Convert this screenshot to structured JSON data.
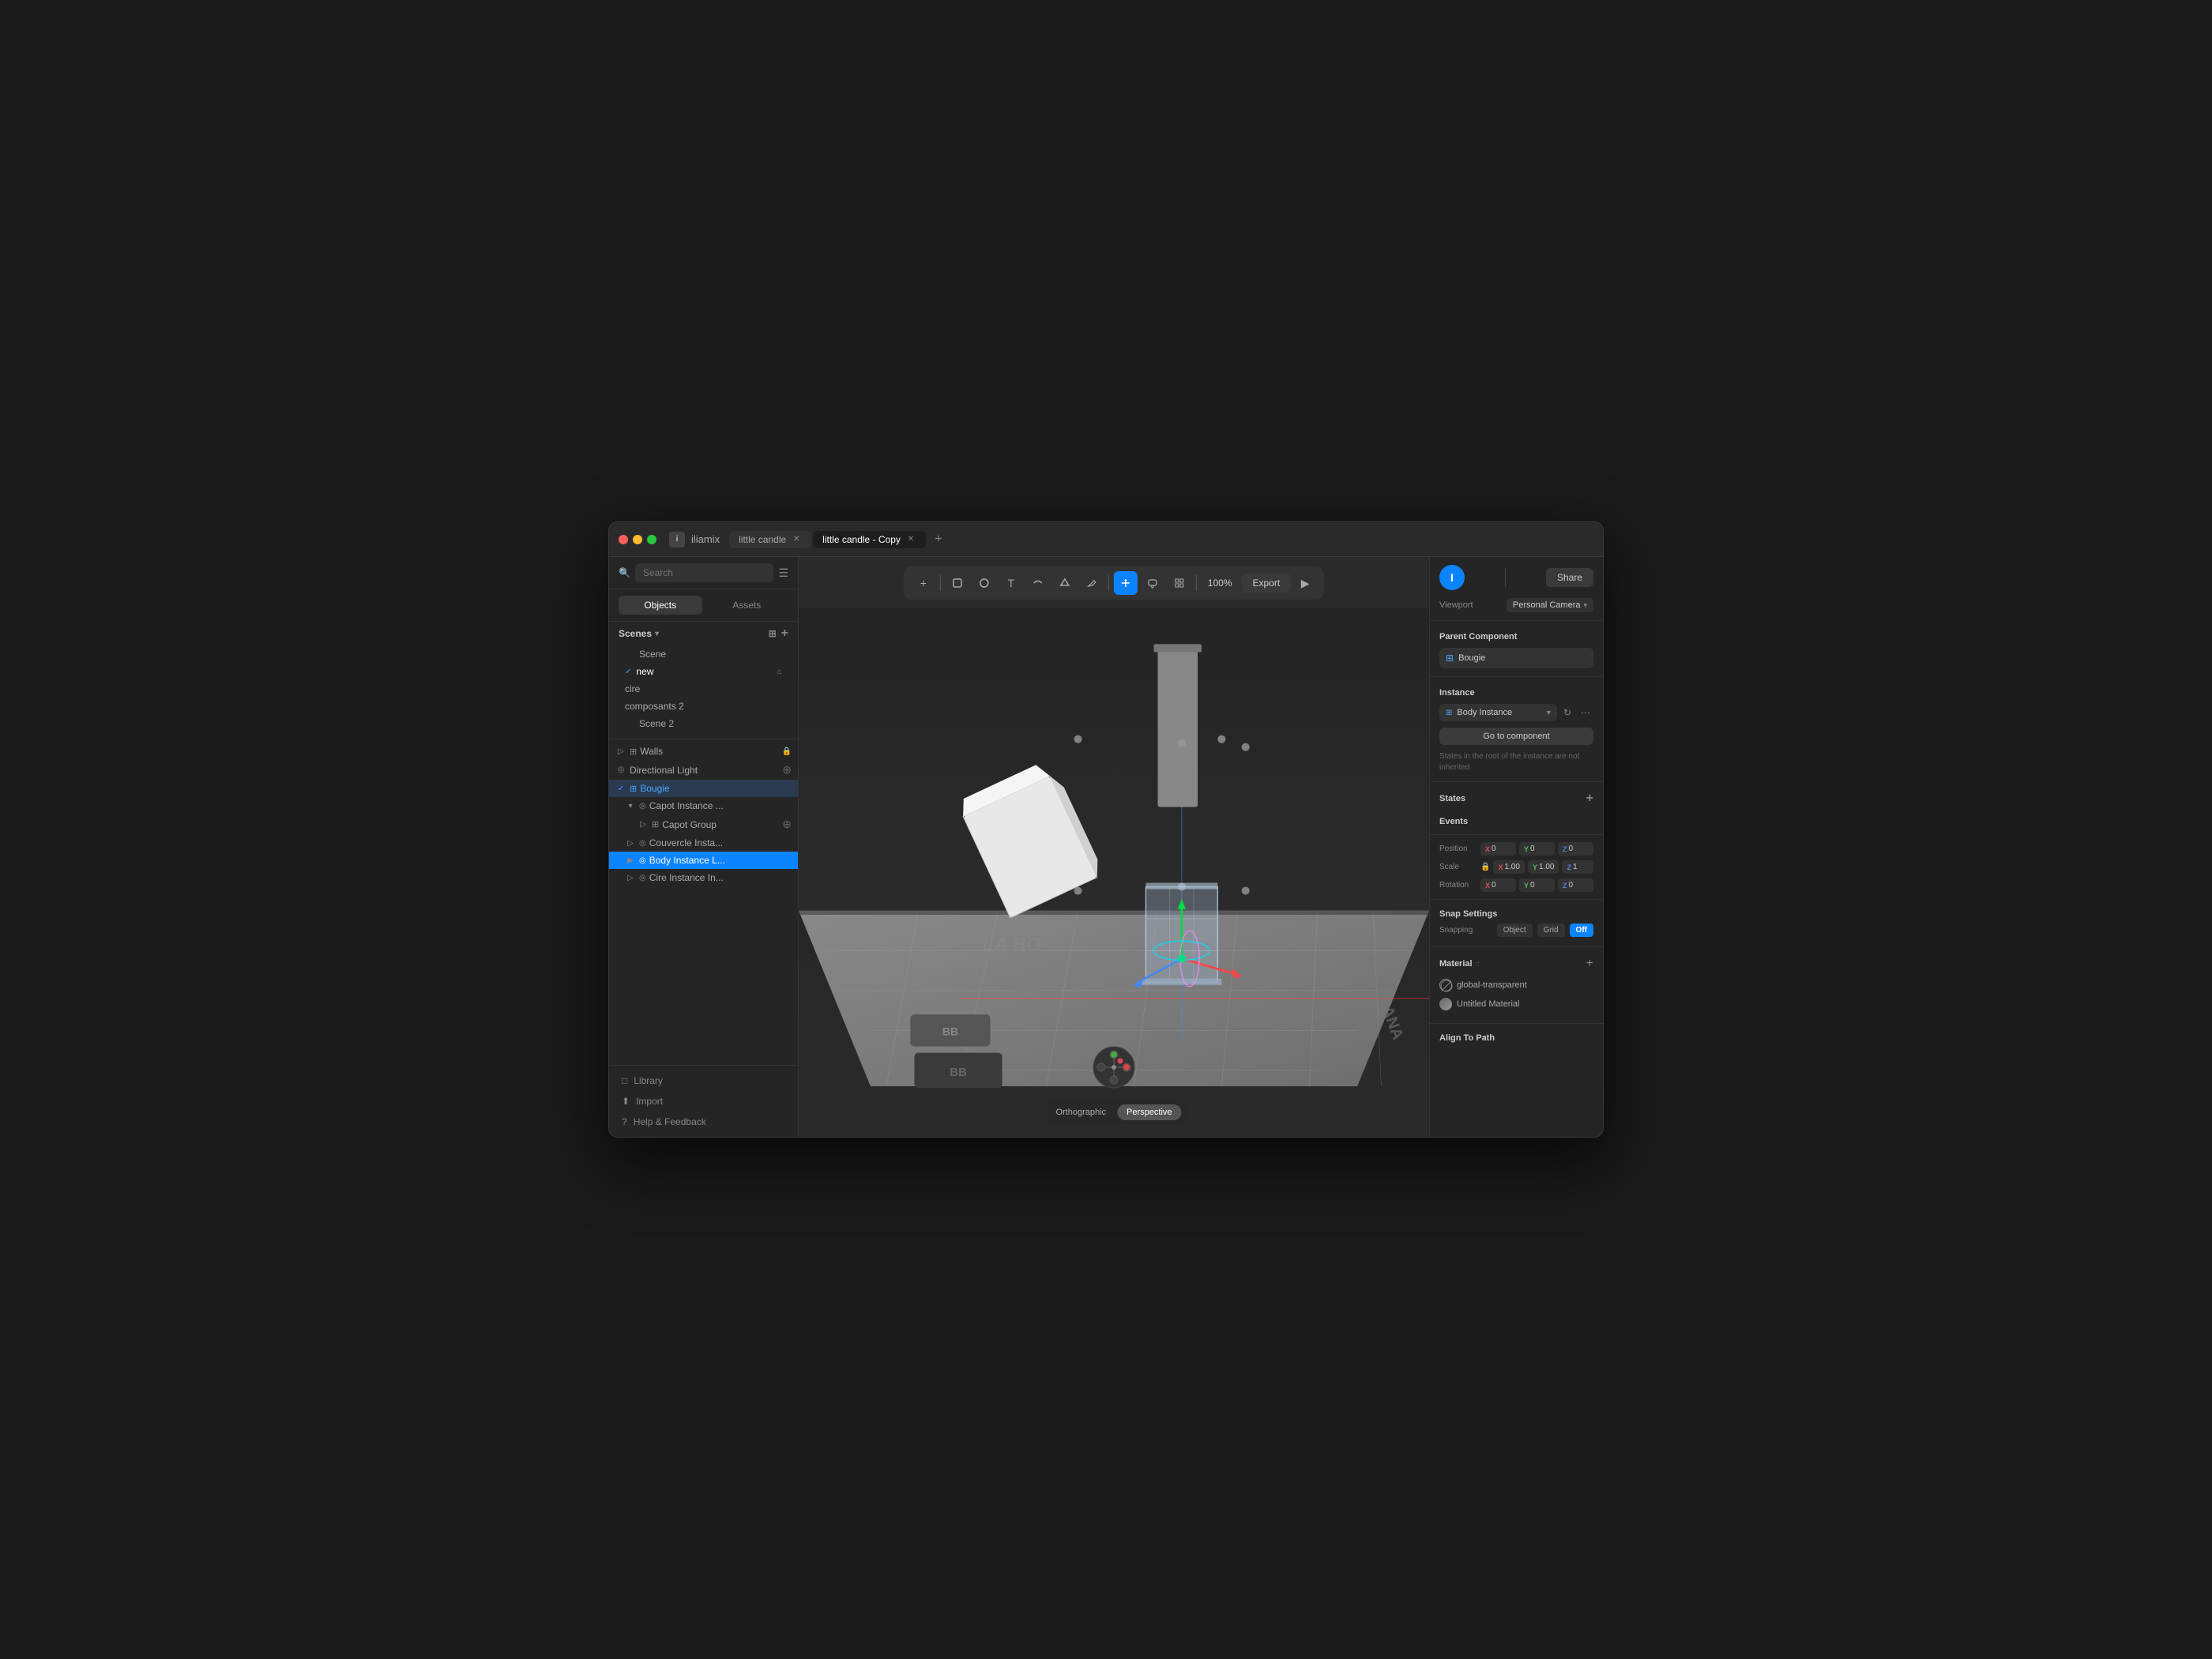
{
  "window": {
    "app_icon": "i",
    "app_name": "iliamix",
    "tabs": [
      {
        "label": "little candle",
        "active": false
      },
      {
        "label": "little candle - Copy",
        "active": true
      }
    ],
    "tab_add": "+"
  },
  "toolbar": {
    "zoom": "100%",
    "export_label": "Export"
  },
  "left_panel": {
    "search_placeholder": "Search",
    "tabs": [
      {
        "label": "Objects",
        "active": true
      },
      {
        "label": "Assets",
        "active": false
      }
    ],
    "scenes_label": "Scenes",
    "scenes": [
      {
        "label": "Scene",
        "active": false,
        "check": false
      },
      {
        "label": "new",
        "active": true,
        "check": true
      },
      {
        "label": "cire",
        "active": false,
        "check": false
      },
      {
        "label": "composants 2",
        "active": false,
        "check": false
      },
      {
        "label": "Scene 2",
        "active": false,
        "check": false
      }
    ],
    "tree": [
      {
        "label": "Walls",
        "icon": "▷",
        "indent": 0,
        "lock": true,
        "type": "group"
      },
      {
        "label": "Directional Light",
        "icon": "◎",
        "indent": 0,
        "type": "light",
        "plus": true
      },
      {
        "label": "Bougie",
        "icon": "⊞",
        "indent": 0,
        "type": "component",
        "highlighted": true
      },
      {
        "label": "Capot Instance ...",
        "icon": "◎",
        "indent": 1,
        "type": "instance"
      },
      {
        "label": "Capot Group",
        "icon": "▷",
        "indent": 2,
        "type": "group",
        "plus": true
      },
      {
        "label": "Couvercle Insta...",
        "icon": "◎",
        "indent": 1,
        "type": "instance"
      },
      {
        "label": "Body Instance L...",
        "icon": "◎",
        "indent": 1,
        "type": "instance",
        "selected": true
      },
      {
        "label": "Cire Instance In...",
        "icon": "◎",
        "indent": 1,
        "type": "instance"
      }
    ],
    "bottom_links": [
      {
        "label": "Library",
        "icon": "□"
      },
      {
        "label": "Import",
        "icon": "↑"
      },
      {
        "label": "Help & Feedback",
        "icon": "?"
      }
    ]
  },
  "viewport": {
    "view_buttons": [
      {
        "label": "Orthographic",
        "active": false
      },
      {
        "label": "Perspective",
        "active": true
      }
    ]
  },
  "right_panel": {
    "avatar_letter": "I",
    "share_label": "Share",
    "viewport_label": "Viewport",
    "camera_label": "Personal Camera",
    "parent_component_label": "Parent Component",
    "bougie_label": "Bougie",
    "instance_label": "Instance",
    "instance_value": "Body Instance",
    "go_to_component": "Go to component",
    "note": "States in the root of the instance are not inherited.",
    "states_label": "States",
    "events_label": "Events",
    "position_label": "Position",
    "position": {
      "x": "0",
      "y": "0",
      "z": "0"
    },
    "scale_label": "Scale",
    "scale": {
      "x": "1.00",
      "y": "1.00",
      "z": "1"
    },
    "rotation_label": "Rotation",
    "rotation": {
      "x": "0",
      "y": "0",
      "z": "0"
    },
    "snap_settings_label": "Snap Settings",
    "snapping_label": "Snapping",
    "object_label": "Object",
    "grid_label": "Grid",
    "off_label": "Off",
    "material_label": "Material",
    "materials": [
      {
        "name": "global-transparent",
        "type": "transparent"
      },
      {
        "name": "Untitled Material",
        "type": "material"
      }
    ],
    "align_to_path_label": "Align To Path"
  }
}
